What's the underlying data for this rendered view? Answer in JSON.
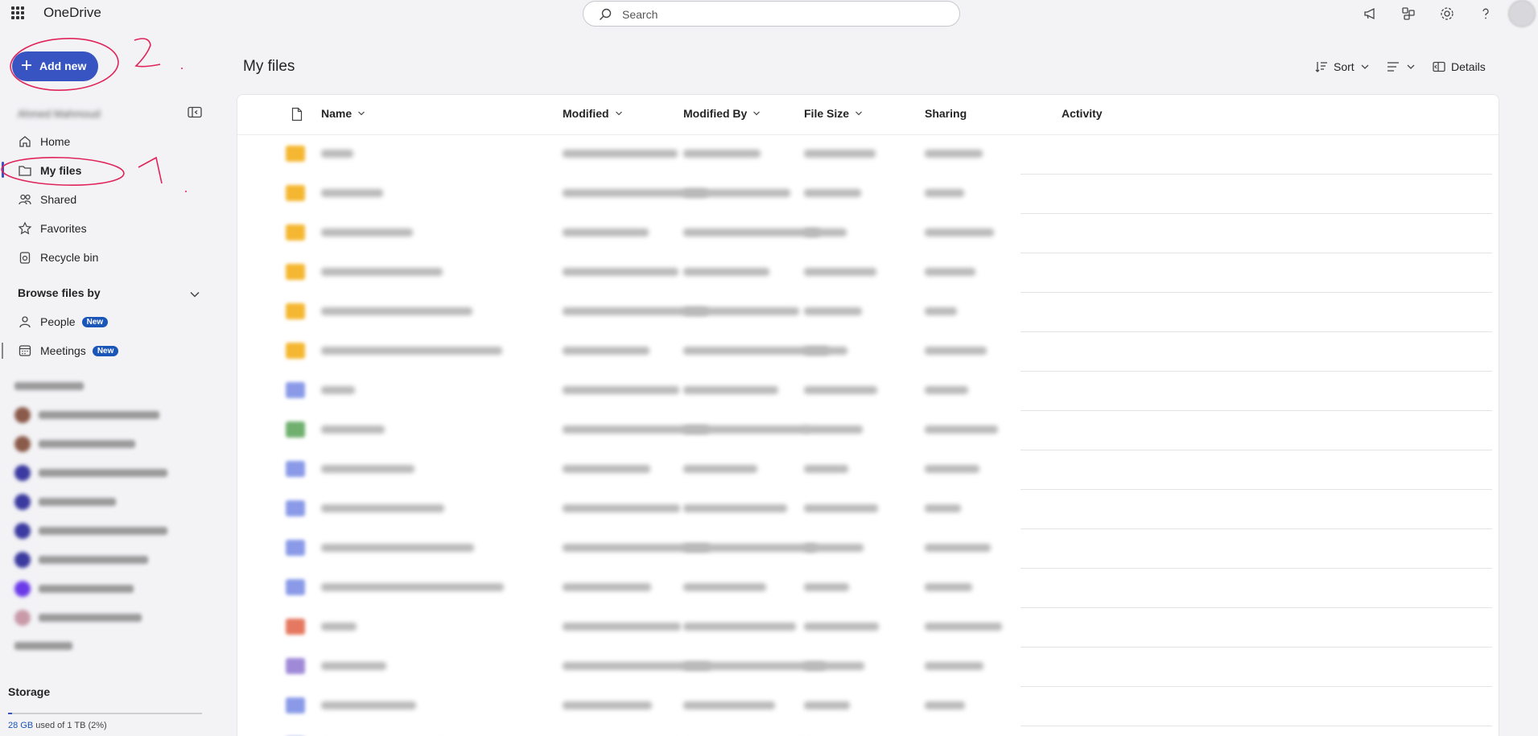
{
  "app": {
    "title": "OneDrive"
  },
  "search": {
    "placeholder": "Search"
  },
  "sidebar": {
    "add_new_label": "Add new",
    "annotation_1": "1",
    "annotation_2": "2.",
    "nav": [
      {
        "label": "Home",
        "icon": "home-icon"
      },
      {
        "label": "My files",
        "icon": "folder-icon",
        "active": true
      },
      {
        "label": "Shared",
        "icon": "people-icon"
      },
      {
        "label": "Favorites",
        "icon": "star-icon"
      },
      {
        "label": "Recycle bin",
        "icon": "recycle-bin-icon"
      }
    ],
    "browse_title": "Browse files by",
    "browse": [
      {
        "label": "People",
        "badge": "New",
        "icon": "person-icon"
      },
      {
        "label": "Meetings",
        "badge": "New",
        "icon": "calendar-icon"
      }
    ],
    "storage": {
      "title": "Storage",
      "used": "28 GB",
      "rest": " used of 1 TB (2%)",
      "fraction": 0.02
    }
  },
  "main": {
    "title": "My files",
    "commands": {
      "sort": "Sort",
      "details": "Details"
    },
    "columns": [
      "Name",
      "Modified",
      "Modified By",
      "File Size",
      "Sharing",
      "Activity"
    ],
    "rows": [
      {
        "type": "folder",
        "color": "#f5b731"
      },
      {
        "type": "folder",
        "color": "#f5b731"
      },
      {
        "type": "folder",
        "color": "#f5b731"
      },
      {
        "type": "folder",
        "color": "#f5b731"
      },
      {
        "type": "folder",
        "color": "#f5b731"
      },
      {
        "type": "folder",
        "color": "#f5b731"
      },
      {
        "type": "document",
        "color": "#8a9ae8"
      },
      {
        "type": "spreadsheet",
        "color": "#6fb06f"
      },
      {
        "type": "document",
        "color": "#8a9ae8"
      },
      {
        "type": "document",
        "color": "#8a9ae8"
      },
      {
        "type": "document",
        "color": "#8a9ae8"
      },
      {
        "type": "document",
        "color": "#8a9ae8"
      },
      {
        "type": "presentation",
        "color": "#e57860"
      },
      {
        "type": "media",
        "color": "#a08ad8"
      },
      {
        "type": "document",
        "color": "#8a9ae8"
      },
      {
        "type": "document",
        "color": "#8a9ae8"
      }
    ]
  },
  "colors": {
    "accent": "#3754c2",
    "annotation": "#e0245a",
    "badge": "#1a55b8"
  }
}
